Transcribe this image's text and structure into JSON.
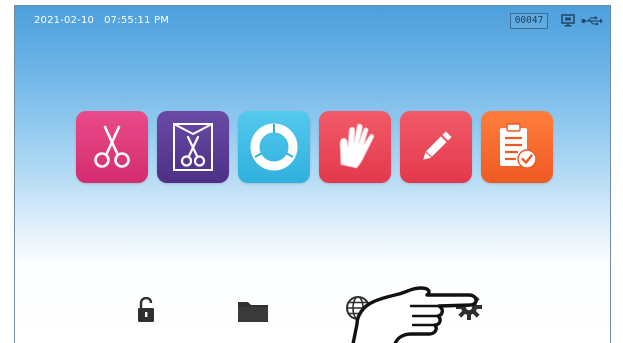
{
  "status_bar": {
    "date": "2021-02-10",
    "time": "07:55:11 PM",
    "counter": "00047",
    "icons": [
      "display-icon",
      "usb-icon"
    ]
  },
  "program_tiles": [
    {
      "name": "instruments-program",
      "icon": "scissors-icon",
      "color": "#e0377a"
    },
    {
      "name": "pouched-instruments-program",
      "icon": "pouched-scissors-icon",
      "color": "#5b3d95"
    },
    {
      "name": "cycle-program",
      "icon": "cycle-ring-icon",
      "color": "#3fbfe6"
    },
    {
      "name": "glove-program",
      "icon": "glove-icon",
      "color": "#ec4a5c"
    },
    {
      "name": "edit-program",
      "icon": "pencil-icon",
      "color": "#ec4a5c"
    },
    {
      "name": "checklist-program",
      "icon": "clipboard-check-icon",
      "color": "#f26a2f"
    }
  ],
  "bottom_toolbar": {
    "icons": [
      "unlock-icon",
      "folder-icon",
      "globe-icon",
      "gear-icon"
    ]
  },
  "overlay": {
    "icon": "pointing-hand-icon"
  }
}
